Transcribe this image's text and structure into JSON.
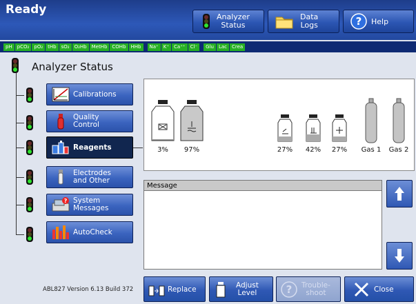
{
  "header": {
    "title": "Ready",
    "analyzer_status": {
      "line1": "Analyzer",
      "line2": "Status"
    },
    "data_logs": {
      "line1": "Data",
      "line2": "Logs"
    },
    "help": "Help"
  },
  "parameters": [
    "pH",
    "pCO₂",
    "pO₂",
    "tHb",
    "sO₂",
    "O₂Hb",
    "MetHb",
    "COHb",
    "HHb",
    "Na⁺",
    "K⁺",
    "Ca⁺⁺",
    "Cl⁻",
    "Glu",
    "Lac",
    "Crea"
  ],
  "panel": {
    "title": "Analyzer Status"
  },
  "nav": {
    "calibrations": "Calibrations",
    "quality_control": {
      "line1": "Quality",
      "line2": "Control"
    },
    "reagents": "Reagents",
    "electrodes": {
      "line1": "Electrodes",
      "line2": "and Other"
    },
    "system_messages": {
      "line1": "System",
      "line2": "Messages"
    },
    "autocheck": "AutoCheck"
  },
  "reagents": {
    "bottles": [
      {
        "label": "3%",
        "fill": 0.03
      },
      {
        "label": "97%",
        "fill": 0.97
      },
      {
        "label": "27%",
        "fill": 0.27
      },
      {
        "label": "42%",
        "fill": 0.42
      },
      {
        "label": "27%",
        "fill": 0.27
      }
    ],
    "gases": [
      "Gas 1",
      "Gas 2"
    ]
  },
  "message": {
    "header": "Message"
  },
  "footer": {
    "version": "ABL827 Version 6.13 Build 372",
    "replace": "Replace",
    "adjust": {
      "line1": "Adjust",
      "line2": "Level"
    },
    "troubleshoot": {
      "line1": "Trouble-",
      "line2": "shoot"
    },
    "close": "Close"
  },
  "colors": {
    "header": "#2d58b8",
    "param_ok": "#27b024",
    "status_light": "#2ee52e"
  }
}
